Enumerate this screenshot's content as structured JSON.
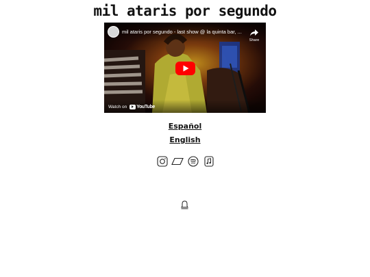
{
  "site": {
    "title": "mil ataris por segundo"
  },
  "video": {
    "title": "mil ataris por segundo - last show @ la quinta bar, ...",
    "share_label": "Share",
    "watch_on_label": "Watch on",
    "youtube_wordmark": "YouTube",
    "play_button_color": "#ff0000"
  },
  "languages": [
    {
      "label": "Español"
    },
    {
      "label": "English"
    }
  ],
  "social": [
    {
      "icon": "instagram-icon"
    },
    {
      "icon": "bandcamp-icon"
    },
    {
      "icon": "spotify-icon"
    },
    {
      "icon": "itunes-icon"
    }
  ],
  "footer": {
    "icon": "bell-icon"
  }
}
